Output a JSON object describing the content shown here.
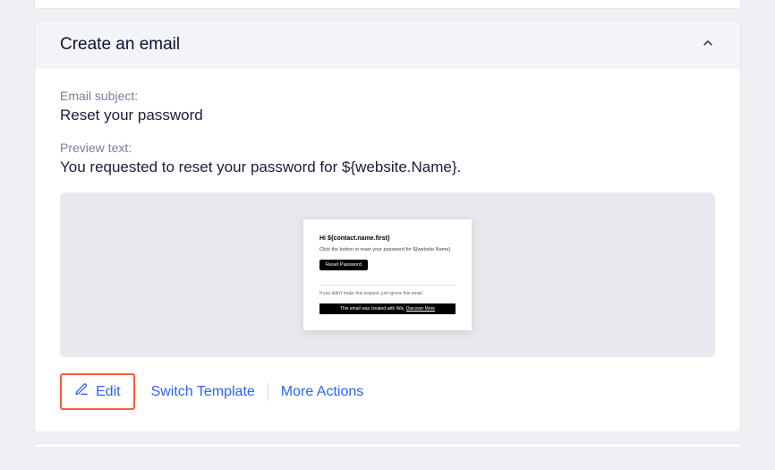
{
  "section": {
    "title": "Create an email",
    "subject_label": "Email subject:",
    "subject_value": "Reset your password",
    "preview_label": "Preview text:",
    "preview_value": "You requested to reset your password for ${website.Name}."
  },
  "thumbnail": {
    "greeting": "Hi ${contact.name.first}",
    "body": "Click the button to reset your password for ${website.Name}.",
    "button": "Reset Password",
    "ignore": "If you didn't make this request, just ignore this email.",
    "banner_prefix": "This email was created with Wix. ",
    "banner_link": "Discover More"
  },
  "actions": {
    "edit": "Edit",
    "switch": "Switch Template",
    "more": "More Actions"
  }
}
